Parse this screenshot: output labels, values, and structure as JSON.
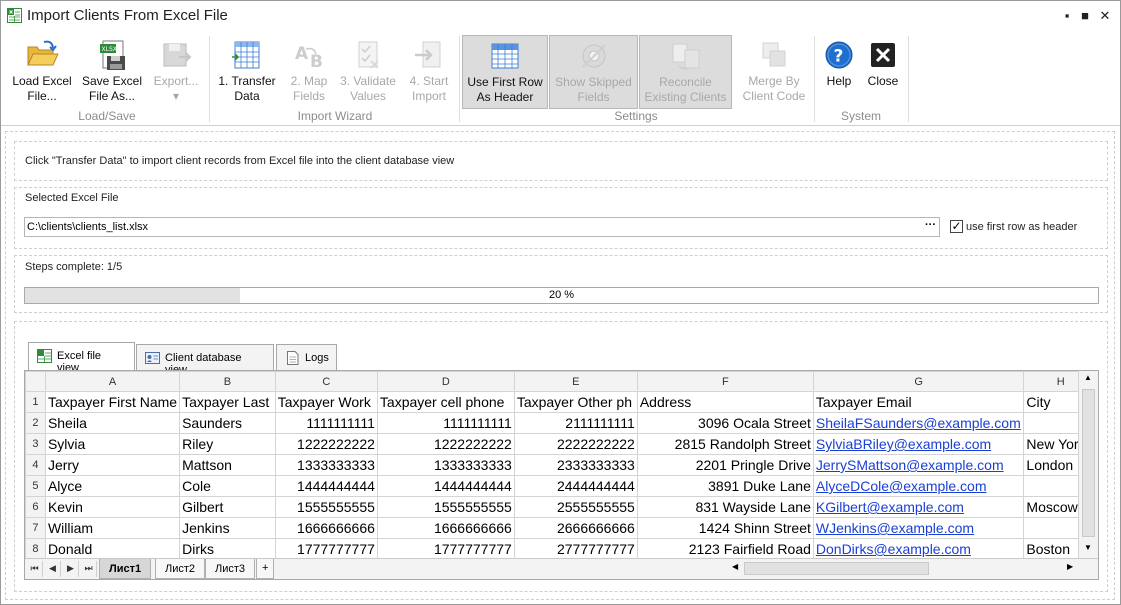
{
  "window": {
    "title": "Import Clients From Excel File",
    "controls": {
      "minimize": "▪",
      "maximize": "■",
      "close": "✕"
    }
  },
  "ribbon": {
    "groups": [
      {
        "label": "Load/Save"
      },
      {
        "label": "Import Wizard"
      },
      {
        "label": "Settings"
      },
      {
        "label": "System"
      }
    ],
    "buttons": {
      "load": {
        "line1": "Load Excel",
        "line2": "File..."
      },
      "save": {
        "line1": "Save Excel",
        "line2": "File As..."
      },
      "export": {
        "line1": "Export...",
        "line2": "▾"
      },
      "transfer": {
        "line1": "1. Transfer",
        "line2": "Data"
      },
      "map": {
        "line1": "2. Map",
        "line2": "Fields"
      },
      "validate": {
        "line1": "3. Validate",
        "line2": "Values"
      },
      "start": {
        "line1": "4. Start",
        "line2": "Import"
      },
      "first_row": {
        "line1": "Use First Row",
        "line2": "As Header"
      },
      "show_skipped": {
        "line1": "Show Skipped",
        "line2": "Fields"
      },
      "reconcile": {
        "line1": "Reconcile",
        "line2": "Existing Clients"
      },
      "merge": {
        "line1": "Merge By",
        "line2": "Client Code"
      },
      "help": {
        "line1": "Help"
      },
      "close": {
        "line1": "Close"
      }
    }
  },
  "instruction": "Click \"Transfer Data\" to import client records from Excel file into the client database view",
  "file_section": {
    "label": "Selected Excel File",
    "path": "C:\\clients\\clients_list.xlsx",
    "browse": "···",
    "use_first_row": {
      "checked": true,
      "mark": "✓",
      "label": "use first row as header"
    }
  },
  "steps": {
    "label": "Steps complete:  1/5",
    "progress": 0.2,
    "progress_text": "20 %"
  },
  "tabs": [
    {
      "label": "Excel file view",
      "icon": "excel-sheet-icon"
    },
    {
      "label": "Client database view",
      "icon": "id-card-icon"
    },
    {
      "label": "Logs",
      "icon": "document-icon"
    }
  ],
  "sheet": {
    "columns": [
      "A",
      "B",
      "C",
      "D",
      "E",
      "F",
      "G",
      "H"
    ],
    "rows": [
      {
        "n": "1",
        "cells": [
          "Taxpayer First Name",
          "Taxpayer Last",
          "Taxpayer Work",
          "Taxpayer cell phone",
          "Taxpayer Other ph",
          "Address",
          "Taxpayer Email",
          "City"
        ]
      },
      {
        "n": "2",
        "cells": [
          "Sheila",
          "Saunders",
          "1111111111",
          "1111111111",
          "2111111111",
          "3096 Ocala Street",
          "SheilaFSaunders@example.com",
          ""
        ]
      },
      {
        "n": "3",
        "cells": [
          "Sylvia",
          "Riley",
          "1222222222",
          "1222222222",
          "2222222222",
          "2815 Randolph Street",
          "SylviaBRiley@example.com",
          "New York"
        ]
      },
      {
        "n": "4",
        "cells": [
          "Jerry",
          "Mattson",
          "1333333333",
          "1333333333",
          "2333333333",
          "2201 Pringle Drive",
          "JerrySMattson@example.com",
          "London"
        ]
      },
      {
        "n": "5",
        "cells": [
          "Alyce",
          "Cole",
          "1444444444",
          "1444444444",
          "2444444444",
          "3891 Duke Lane",
          "AlyceDCole@example.com",
          ""
        ]
      },
      {
        "n": "6",
        "cells": [
          "Kevin",
          "Gilbert",
          "1555555555",
          "1555555555",
          "2555555555",
          "831 Wayside Lane",
          "KGilbert@example.com",
          "Moscow"
        ]
      },
      {
        "n": "7",
        "cells": [
          "William",
          "Jenkins",
          "1666666666",
          "1666666666",
          "2666666666",
          "1424 Shinn Street",
          "WJenkins@example.com",
          ""
        ]
      },
      {
        "n": "8",
        "cells": [
          "Donald",
          "Dirks",
          "1777777777",
          "1777777777",
          "2777777777",
          "2123 Fairfield Road",
          "DonDirks@example.com",
          "Boston"
        ]
      }
    ],
    "sheet_tabs": [
      "Лист1",
      "Лист2",
      "Лист3"
    ],
    "nav": {
      "first": "⏮",
      "prev": "◀",
      "next": "▶",
      "last": "⏭",
      "add": "+",
      "up": "▲",
      "down": "▼",
      "left": "◀",
      "right": "▶"
    }
  },
  "colors": {
    "accent": "#1a3fd4",
    "help_blue": "#1f6fd1",
    "close_dark": "#222222",
    "excel_green": "#2e8b3a"
  }
}
